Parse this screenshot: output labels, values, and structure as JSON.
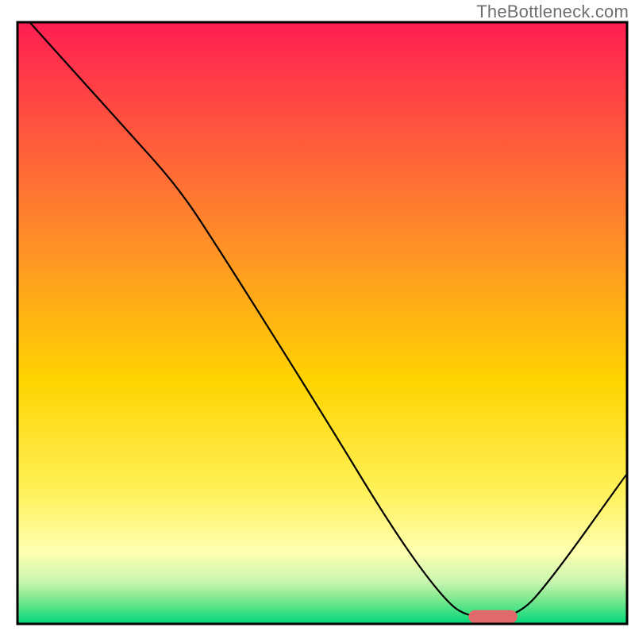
{
  "watermark": "TheBottleneck.com",
  "chart_data": {
    "type": "line",
    "title": "",
    "xlabel": "",
    "ylabel": "",
    "xlim": [
      0,
      100
    ],
    "ylim": [
      0,
      100
    ],
    "background": {
      "type": "vertical-gradient",
      "stops": [
        {
          "pos": 0.0,
          "color": "#ff1e52"
        },
        {
          "pos": 0.35,
          "color": "#ff8a2a"
        },
        {
          "pos": 0.6,
          "color": "#ffd500"
        },
        {
          "pos": 0.78,
          "color": "#fff15a"
        },
        {
          "pos": 0.88,
          "color": "#ffffb0"
        },
        {
          "pos": 0.93,
          "color": "#c9f5b0"
        },
        {
          "pos": 0.96,
          "color": "#7be88e"
        },
        {
          "pos": 1.0,
          "color": "#00d87a"
        }
      ]
    },
    "series": [
      {
        "name": "bottleneck-curve",
        "color": "#000000",
        "stroke_width": 2.2,
        "points": [
          {
            "x": 2,
            "y": 100
          },
          {
            "x": 18,
            "y": 82
          },
          {
            "x": 26,
            "y": 73
          },
          {
            "x": 32,
            "y": 64
          },
          {
            "x": 50,
            "y": 35
          },
          {
            "x": 62,
            "y": 15
          },
          {
            "x": 70,
            "y": 4
          },
          {
            "x": 74,
            "y": 1
          },
          {
            "x": 82,
            "y": 1
          },
          {
            "x": 88,
            "y": 8
          },
          {
            "x": 100,
            "y": 25
          }
        ]
      }
    ],
    "marker": {
      "name": "optimal-range",
      "shape": "rounded-bar",
      "color": "#e06a6a",
      "x_center": 78,
      "y": 1.2,
      "width": 8,
      "height": 2.2
    },
    "frame": {
      "stroke": "#000000",
      "stroke_width": 3
    }
  }
}
